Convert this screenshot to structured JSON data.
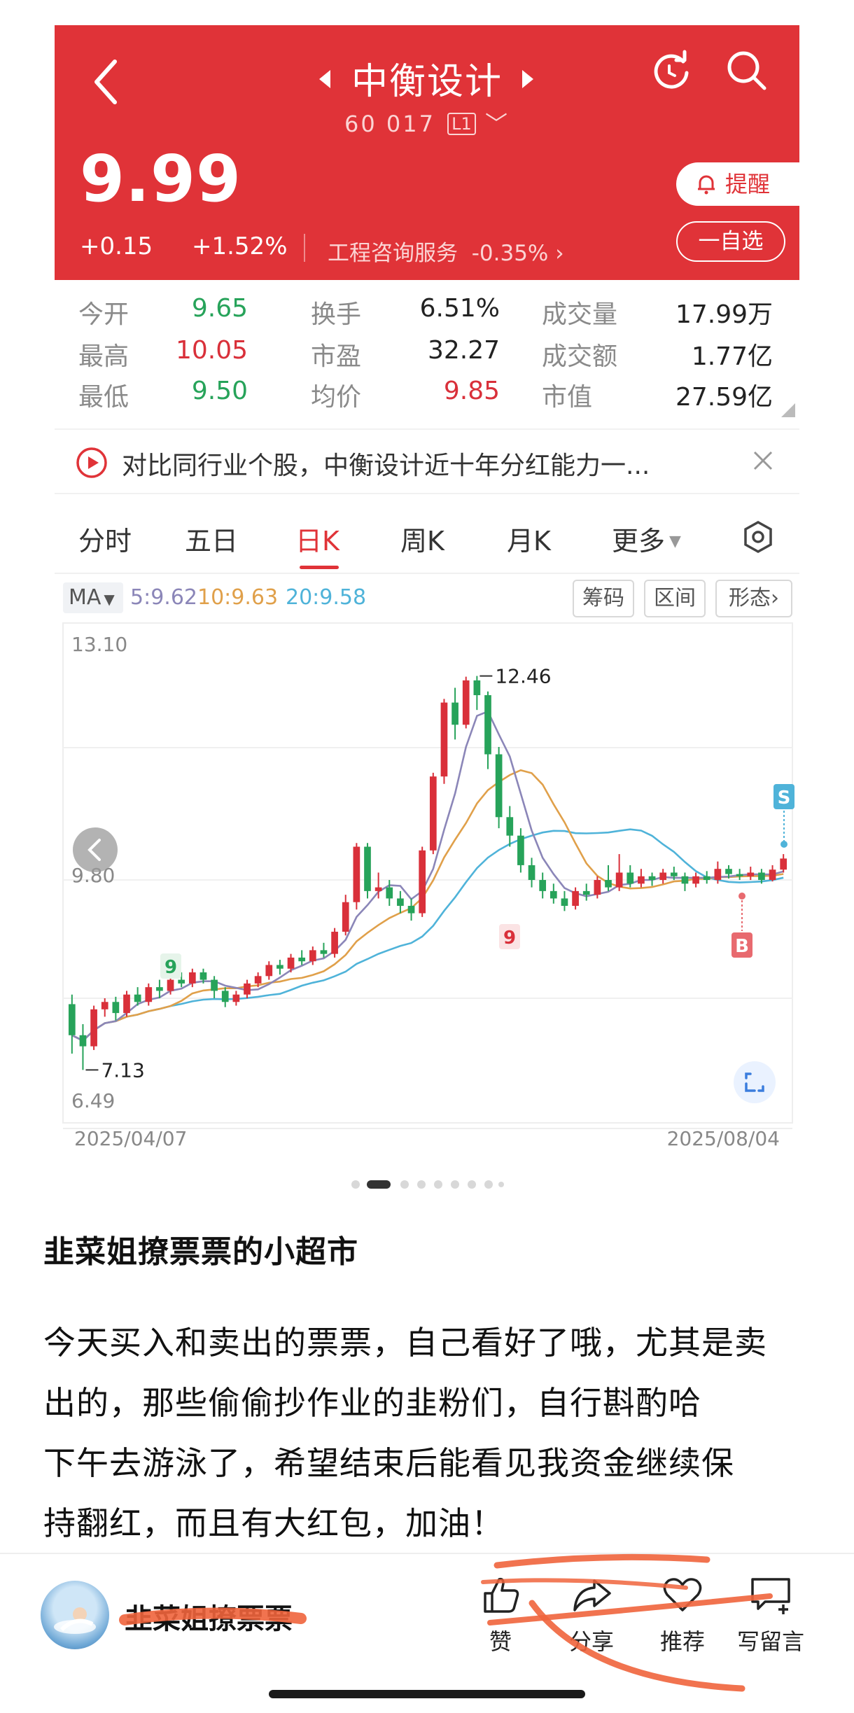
{
  "header": {
    "stock_name": "中衡设计",
    "stock_code": "60 017",
    "level_badge": "L1",
    "price": "9.99",
    "change": "+0.15",
    "change_pct": "+1.52%",
    "industry": "工程咨询服务",
    "industry_change": "-0.35%",
    "alert_label": "提醒",
    "watchlist_label": "一自选"
  },
  "stats": [
    [
      {
        "label": "今开",
        "value": "9.65",
        "tone": "dn"
      },
      {
        "label": "换手",
        "value": "6.51%",
        "tone": "nu"
      },
      {
        "label": "成交量",
        "value": "17.99万",
        "tone": "nu"
      }
    ],
    [
      {
        "label": "最高",
        "value": "10.05",
        "tone": "up"
      },
      {
        "label": "市盈",
        "value": "32.27",
        "tone": "nu"
      },
      {
        "label": "成交额",
        "value": "1.77亿",
        "tone": "nu"
      }
    ],
    [
      {
        "label": "最低",
        "value": "9.50",
        "tone": "dn"
      },
      {
        "label": "均价",
        "value": "9.85",
        "tone": "up"
      },
      {
        "label": "市值",
        "value": "27.59亿",
        "tone": "nu"
      }
    ]
  ],
  "promo": {
    "text": "对比同行业个股，中衡设计近十年分红能力一..."
  },
  "tabs": [
    "分时",
    "五日",
    "日K",
    "周K",
    "月K",
    "更多"
  ],
  "active_tab": "日K",
  "ma": {
    "label": "MA",
    "ma5": "5:9.62",
    "ma10": "10:9.63",
    "ma20": "20:9.58",
    "buttons": [
      "筹码",
      "区间",
      "形态"
    ]
  },
  "colors": {
    "up": "#d9303a",
    "down": "#27a35a",
    "ma5": "#8b86b8",
    "ma10": "#e0a04a",
    "ma20": "#4fb3d9",
    "accent": "#e03338"
  },
  "chart_data": {
    "type": "candlestick",
    "y_top_label": "13.10",
    "y_mid_label": "9.80",
    "y_bottom_label": "6.49",
    "high_marker": "12.46",
    "low_marker": "7.13",
    "x_start": "2025/04/07",
    "x_end": "2025/08/04",
    "ylim": [
      6.49,
      13.1
    ],
    "signals": {
      "buy": "B",
      "sell": "S",
      "count_9": "9"
    },
    "candles": [
      [
        8.02,
        7.6,
        8.15,
        7.35
      ],
      [
        7.6,
        7.45,
        7.75,
        7.13
      ],
      [
        7.45,
        7.95,
        8.0,
        7.4
      ],
      [
        7.95,
        8.05,
        8.1,
        7.85
      ],
      [
        8.05,
        7.9,
        8.12,
        7.8
      ],
      [
        7.9,
        8.15,
        8.2,
        7.85
      ],
      [
        8.15,
        8.05,
        8.25,
        8.0
      ],
      [
        8.05,
        8.25,
        8.3,
        8.0
      ],
      [
        8.25,
        8.2,
        8.35,
        8.1
      ],
      [
        8.2,
        8.35,
        8.4,
        8.15
      ],
      [
        8.35,
        8.3,
        8.45,
        8.25
      ],
      [
        8.3,
        8.45,
        8.5,
        8.25
      ],
      [
        8.45,
        8.35,
        8.5,
        8.3
      ],
      [
        8.35,
        8.2,
        8.4,
        8.1
      ],
      [
        8.2,
        8.05,
        8.25,
        7.98
      ],
      [
        8.05,
        8.15,
        8.2,
        8.0
      ],
      [
        8.15,
        8.3,
        8.35,
        8.1
      ],
      [
        8.3,
        8.4,
        8.45,
        8.25
      ],
      [
        8.4,
        8.55,
        8.6,
        8.35
      ],
      [
        8.55,
        8.5,
        8.62,
        8.42
      ],
      [
        8.5,
        8.65,
        8.7,
        8.45
      ],
      [
        8.65,
        8.6,
        8.75,
        8.55
      ],
      [
        8.6,
        8.75,
        8.8,
        8.55
      ],
      [
        8.75,
        8.7,
        8.85,
        8.65
      ],
      [
        8.7,
        9.0,
        9.05,
        8.65
      ],
      [
        9.0,
        9.4,
        9.5,
        8.95
      ],
      [
        9.4,
        10.15,
        10.2,
        9.3
      ],
      [
        10.15,
        9.55,
        10.2,
        9.45
      ],
      [
        9.55,
        9.6,
        9.8,
        9.45
      ],
      [
        9.6,
        9.45,
        9.7,
        9.35
      ],
      [
        9.45,
        9.35,
        9.55,
        9.25
      ],
      [
        9.35,
        9.25,
        9.45,
        9.15
      ],
      [
        9.25,
        10.1,
        10.15,
        9.2
      ],
      [
        10.1,
        11.1,
        11.15,
        10.05
      ],
      [
        11.1,
        12.1,
        12.15,
        11.0
      ],
      [
        12.1,
        11.8,
        12.3,
        11.6
      ],
      [
        11.8,
        12.4,
        12.45,
        11.75
      ],
      [
        12.4,
        12.2,
        12.46,
        12.0
      ],
      [
        12.2,
        11.4,
        12.25,
        11.2
      ],
      [
        11.4,
        10.55,
        11.5,
        10.4
      ],
      [
        10.55,
        10.3,
        10.7,
        10.15
      ],
      [
        10.3,
        9.9,
        10.4,
        9.8
      ],
      [
        9.9,
        9.7,
        10.0,
        9.6
      ],
      [
        9.7,
        9.55,
        9.8,
        9.45
      ],
      [
        9.55,
        9.45,
        9.65,
        9.38
      ],
      [
        9.45,
        9.35,
        9.55,
        9.28
      ],
      [
        9.35,
        9.55,
        9.6,
        9.3
      ],
      [
        9.55,
        9.5,
        9.65,
        9.42
      ],
      [
        9.5,
        9.7,
        9.75,
        9.45
      ],
      [
        9.7,
        9.6,
        9.9,
        9.55
      ],
      [
        9.6,
        9.8,
        10.05,
        9.55
      ],
      [
        9.8,
        9.65,
        9.9,
        9.6
      ],
      [
        9.65,
        9.75,
        9.85,
        9.6
      ],
      [
        9.75,
        9.7,
        9.8,
        9.62
      ],
      [
        9.7,
        9.8,
        9.85,
        9.65
      ],
      [
        9.8,
        9.75,
        9.88,
        9.7
      ],
      [
        9.75,
        9.65,
        9.8,
        9.55
      ],
      [
        9.65,
        9.75,
        9.8,
        9.6
      ],
      [
        9.75,
        9.7,
        9.82,
        9.65
      ],
      [
        9.7,
        9.85,
        9.95,
        9.65
      ],
      [
        9.85,
        9.78,
        9.9,
        9.72
      ],
      [
        9.78,
        9.75,
        9.85,
        9.7
      ],
      [
        9.75,
        9.8,
        9.88,
        9.7
      ],
      [
        9.8,
        9.7,
        9.85,
        9.65
      ],
      [
        9.7,
        9.84,
        9.9,
        9.68
      ],
      [
        9.84,
        9.99,
        10.05,
        9.8
      ]
    ]
  },
  "post": {
    "title": "韭菜姐撩票票的小超市",
    "lines": [
      "今天买入和卖出的票票，自己看好了哦，尤其是卖",
      "出的，那些偷偷抄作业的韭粉们，自行斟酌哈",
      "下午去游泳了，希望结束后能看见我资金继续保",
      "持翻红，而且有大红包，加油！"
    ]
  },
  "footer": {
    "username": "韭菜姐撩票票",
    "actions": [
      "赞",
      "分享",
      "推荐",
      "写留言"
    ]
  }
}
